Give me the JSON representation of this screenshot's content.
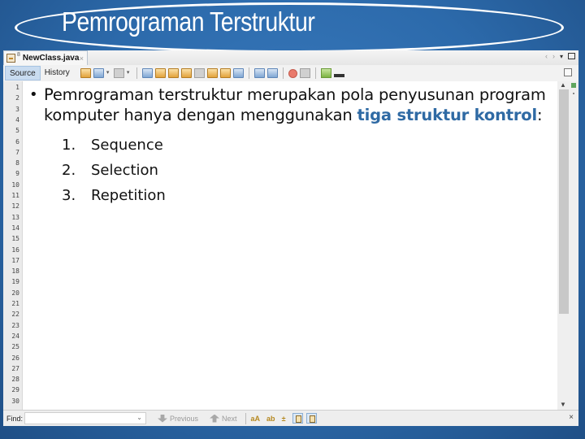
{
  "slide": {
    "title": "Pemrograman Terstruktur"
  },
  "ide": {
    "file_tab": {
      "label": "NewClass.java",
      "superscript": "8",
      "close": "×"
    },
    "window_controls": {
      "prev": "‹",
      "next": "›",
      "menu": "▾"
    },
    "view_tabs": [
      {
        "label": "Source",
        "active": true
      },
      {
        "label": "History",
        "active": false
      }
    ],
    "toolbar_icons": [
      "last-edit-icon",
      "back-icon",
      "forward-icon",
      "find-icon",
      "find-prev-icon",
      "find-next-icon",
      "toggle-highlight-icon",
      "select-icon",
      "prev-bookmark-icon",
      "next-bookmark-icon",
      "toggle-bookmark-icon",
      "shift-left-icon",
      "shift-right-icon",
      "record-macro-icon",
      "stop-macro-icon",
      "comment-icon",
      "uncomment-icon"
    ],
    "line_numbers": [
      "1",
      "2",
      "3",
      "4",
      "5",
      "6",
      "7",
      "8",
      "9",
      "10",
      "11",
      "12",
      "13",
      "14",
      "15",
      "16",
      "17",
      "18",
      "19",
      "20",
      "21",
      "22",
      "23",
      "24",
      "25",
      "26",
      "27",
      "28",
      "29",
      "30"
    ],
    "find_bar": {
      "label": "Find:",
      "value": "",
      "previous_label": "Previous",
      "next_label": "Next",
      "options": [
        "aA",
        "ab",
        "±"
      ],
      "close": "×"
    }
  },
  "content": {
    "bullet_parts": {
      "before": "Pemrograman terstruktur merupakan pola penyusunan program komputer hanya dengan menggunakan ",
      "highlight": "tiga struktur kontrol",
      "after": ":"
    },
    "list": [
      {
        "num": "1.",
        "text": "Sequence"
      },
      {
        "num": "2.",
        "text": "Selection"
      },
      {
        "num": "3.",
        "text": "Repetition"
      }
    ],
    "highlight_color": "#2f6aa4"
  }
}
